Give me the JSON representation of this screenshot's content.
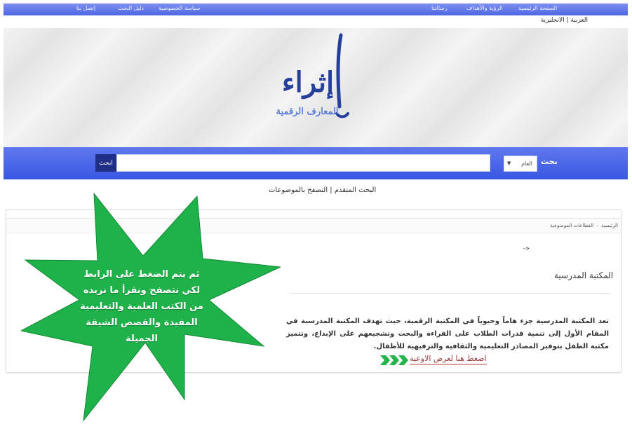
{
  "topnav": {
    "items": [
      "الصفحة الرئيسية",
      "الرؤية والأهداف",
      "رسالتنا",
      "سياسة الخصوصية",
      "دليل البحث",
      "إتصل بنا"
    ]
  },
  "language": "العربية | الانجليزية",
  "logo": {
    "title": "إثراء",
    "subtitle": "المعارف الرقمية"
  },
  "search": {
    "label": "بحث",
    "scope": "العام",
    "button": "ابحث",
    "placeholder": ""
  },
  "sublinks": "البحث المتقدم | التصفح بالموضوعات",
  "breadcrumb": [
    "الرئيسية",
    "القطاعات الموضوعية"
  ],
  "content": {
    "arrow_mark": "-»",
    "section_title": "المكتبة المدرسية",
    "description": "تعد المكتبة المدرسية جزء هاماً وحيوياً في المكتبة الرقمية، حيث تهدف المكتبة المدرسية في المقام الأول إلى تنمية قدرات الطلاب على القراءة والبحث وتشجيعهم على الإبداع، وتتميز مكتبة الطفل بتوفير المصادر التعليمية والثقافية والترفيهية للأطفال.",
    "cta": "اضغط هنا لعرض الاوعية"
  },
  "callout": {
    "text": "ثم يتم الضغط على الرابط لكي نتصفح ونقرأ ما نريده من الكتب العلمية والتعليمية المفيدة والقصص الشيقة الجميلة"
  },
  "colors": {
    "nav": "#5a70e8",
    "brand_dark": "#253f9a",
    "callout_green": "#1fb14a",
    "chevrons": "#25b34c"
  }
}
